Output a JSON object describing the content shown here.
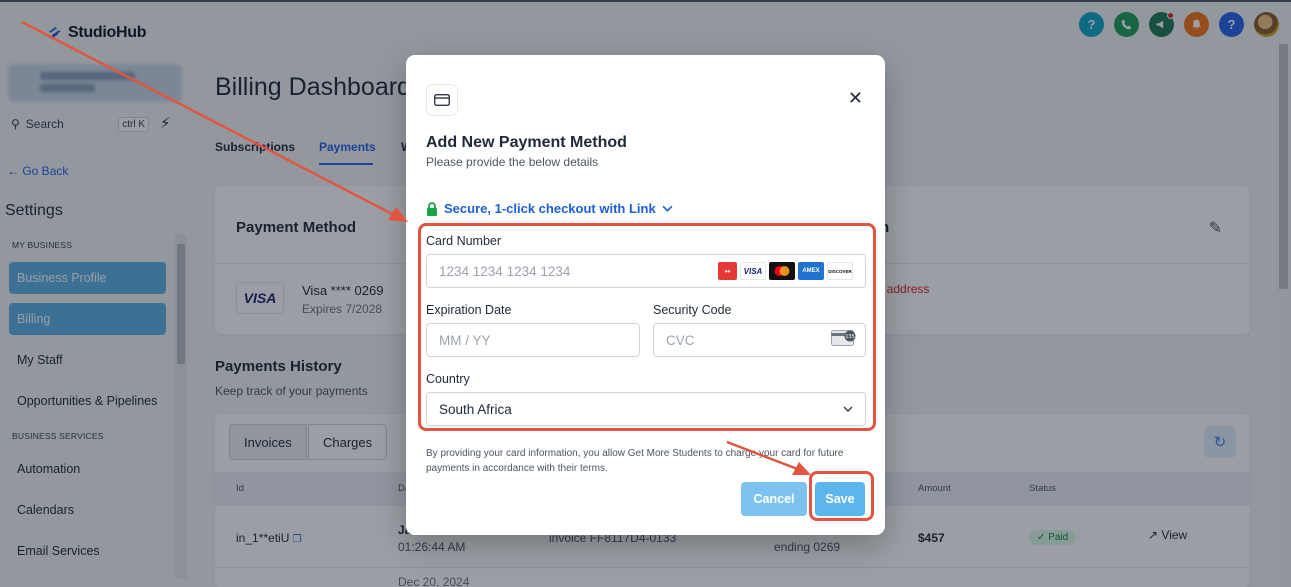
{
  "app": {
    "name": "StudioHub"
  },
  "topbar": {
    "icons": [
      {
        "name": "help-icon",
        "glyph": "?",
        "color": "#0ea5c6"
      },
      {
        "name": "phone-icon",
        "glyph": "✆",
        "color": "#1e9e5a"
      },
      {
        "name": "megaphone-icon",
        "glyph": "📣",
        "color": "#1f7a55"
      },
      {
        "name": "bell-icon",
        "glyph": "🔔",
        "color": "#f97316"
      },
      {
        "name": "help-circle-icon",
        "glyph": "?",
        "color": "#2563eb"
      }
    ]
  },
  "sidebar": {
    "search_label": "Search",
    "search_shortcut": "ctrl K",
    "go_back": "Go Back",
    "settings_title": "Settings",
    "section_business": "MY BUSINESS",
    "section_services": "BUSINESS SERVICES",
    "items": [
      {
        "label": "Business Profile",
        "active": true
      },
      {
        "label": "Billing",
        "active": true
      },
      {
        "label": "My Staff",
        "active": false
      },
      {
        "label": "Opportunities & Pipelines",
        "active": false
      },
      {
        "label": "Automation",
        "active": false
      },
      {
        "label": "Calendars",
        "active": false
      },
      {
        "label": "Email Services",
        "active": false
      }
    ]
  },
  "main": {
    "title": "Billing Dashboard",
    "tabs": [
      "Subscriptions",
      "Payments",
      "W"
    ],
    "payment_method": {
      "heading": "Payment Method",
      "brand": "VISA",
      "number": "Visa **** 0269",
      "expires": "Expires 7/2028",
      "right_heading_fragment": "n",
      "billing_address": "ng address"
    },
    "payments_history": {
      "title": "Payments History",
      "subtitle": "Keep track of your payments",
      "segments": [
        "Invoices",
        "Charges"
      ],
      "columns": {
        "id": "Id",
        "date": "Da",
        "amount": "Amount",
        "status": "Status"
      },
      "row": {
        "id": "in_1**etiU",
        "date": "Ja",
        "time": "01:26:44 AM",
        "description": "invoice FF8117D4-0133",
        "card": "ending 0269",
        "amount": "$457",
        "status": "Paid",
        "action": "View"
      },
      "next_row_date": "Dec 20, 2024"
    }
  },
  "modal": {
    "title": "Add New Payment Method",
    "subtitle": "Please provide the below details",
    "secure_link": "Secure, 1-click checkout with Link",
    "card_number_label": "Card Number",
    "card_number_placeholder": "1234 1234 1234 1234",
    "expiration_label": "Expiration Date",
    "expiration_placeholder": "MM / YY",
    "security_label": "Security Code",
    "security_placeholder": "CVC",
    "country_label": "Country",
    "country_value": "South Africa",
    "card_brands": [
      "VISA",
      "Mastercard",
      "AMEX",
      "DISCOVER"
    ],
    "cvc_badge": "135",
    "disclaimer": "By providing your card information, you allow Get More Students to charge your card for future payments in accordance with their terms.",
    "cancel_label": "Cancel",
    "save_label": "Save"
  },
  "colors": {
    "accent": "#2563eb",
    "sidebar_active": "#5eb0e5",
    "annotation": "#e05640",
    "save_button": "#5cb6ec",
    "paid_badge": "#dcfce7"
  }
}
